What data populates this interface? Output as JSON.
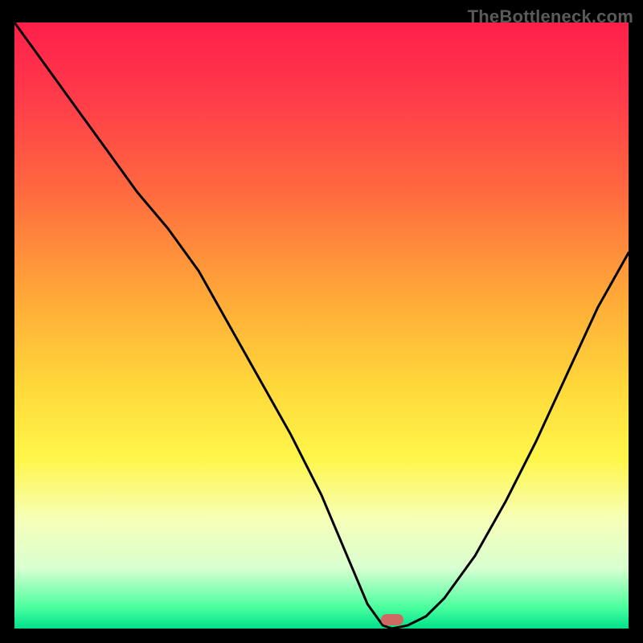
{
  "watermark": "TheBottleneck.com",
  "gradient": {
    "stops": [
      {
        "offset": 0.0,
        "color": "#ff1f4a"
      },
      {
        "offset": 0.12,
        "color": "#ff3a4a"
      },
      {
        "offset": 0.28,
        "color": "#ff6a3f"
      },
      {
        "offset": 0.45,
        "color": "#ffa838"
      },
      {
        "offset": 0.6,
        "color": "#ffd83a"
      },
      {
        "offset": 0.72,
        "color": "#fff64a"
      },
      {
        "offset": 0.82,
        "color": "#f6ffb8"
      },
      {
        "offset": 0.9,
        "color": "#d9ffd0"
      },
      {
        "offset": 0.965,
        "color": "#4bff9f"
      },
      {
        "offset": 1.0,
        "color": "#00e08a"
      }
    ]
  },
  "marker": {
    "x_fraction": 0.615,
    "y_fraction": 0.985,
    "color": "#cf6a63"
  },
  "chart_data": {
    "type": "line",
    "title": "",
    "xlabel": "",
    "ylabel": "",
    "xlim": [
      0,
      1
    ],
    "ylim": [
      0,
      1
    ],
    "series": [
      {
        "name": "curve",
        "x": [
          0.0,
          0.05,
          0.1,
          0.15,
          0.2,
          0.25,
          0.3,
          0.35,
          0.4,
          0.45,
          0.5,
          0.55,
          0.575,
          0.6,
          0.615,
          0.64,
          0.67,
          0.7,
          0.75,
          0.8,
          0.85,
          0.9,
          0.95,
          1.0
        ],
        "y": [
          1.0,
          0.93,
          0.86,
          0.79,
          0.72,
          0.66,
          0.59,
          0.5,
          0.41,
          0.32,
          0.22,
          0.1,
          0.04,
          0.005,
          0.0,
          0.005,
          0.02,
          0.05,
          0.12,
          0.21,
          0.31,
          0.42,
          0.53,
          0.62
        ]
      }
    ],
    "annotations": [
      {
        "type": "marker",
        "x": 0.615,
        "y": 0.0
      }
    ]
  }
}
